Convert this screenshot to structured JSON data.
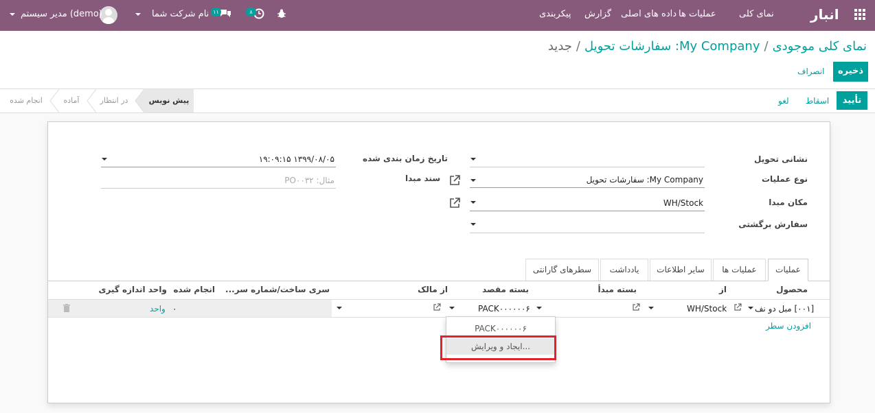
{
  "navbar": {
    "app_title": "انبار",
    "menu": [
      "نمای کلی",
      "عملیات ها",
      "داده های اصلی",
      "گزارش",
      "پیکربندی"
    ],
    "user_label": "مدیر سیستم (demo)",
    "company_label": "نام شرکت شما",
    "messages_count": "۱۱",
    "activities_count": "۸"
  },
  "breadcrumb": {
    "root": "نمای کلی موجودی",
    "parent": "My Company: سفارشات تحویل",
    "current": "جدید"
  },
  "buttons": {
    "save": "ذخیره",
    "discard": "انصراف",
    "validate": "تأیید",
    "scrap": "اسقاط",
    "cancel": "لغو"
  },
  "status_stages": [
    "پیش نویس",
    "در انتظار",
    "آماده",
    "انجام شده"
  ],
  "form": {
    "delivery_address_label": "نشانی تحویل",
    "operation_type_label": "نوع عملیات",
    "operation_type_value": "My Company: سفارشات تحویل",
    "source_location_label": "مکان مبدا",
    "source_location_value": "WH/Stock",
    "return_order_label": "سفارش برگشتی",
    "scheduled_date_label": "تاریخ زمان بندی شده",
    "scheduled_date_value": "۱۳۹۹/۰۸/۰۵ ۱۹:۰۹:۱۵",
    "source_document_label": "سند مبدا",
    "source_document_placeholder": "مثال: PO۰۰۳۲"
  },
  "tabs": [
    "عملیات",
    "عملیات ها",
    "سایر اطلاعات",
    "یادداشت",
    "سطرهای گارانتی"
  ],
  "table": {
    "headers": [
      "محصول",
      "از",
      "بسته مبدأ",
      "بسته مقصد",
      "از مالک",
      "سری ساخت/شماره سر...",
      "انجام شده",
      "واحد اندازه گیری"
    ],
    "row": {
      "product": "[۰۰۱] مبل دو نف",
      "from": "WH/Stock",
      "dest_package": "PACK۰۰۰۰۰۰۶",
      "done": "۰",
      "uom": "واحد"
    },
    "add_line": "افزودن سطر"
  },
  "dropdown": {
    "items": [
      "PACK۰۰۰۰۰۰۶",
      "ایجاد و ویرایش..."
    ]
  },
  "colors": {
    "navbar": "#875a7b",
    "primary": "#00a09d",
    "highlight": "#e3212a"
  }
}
